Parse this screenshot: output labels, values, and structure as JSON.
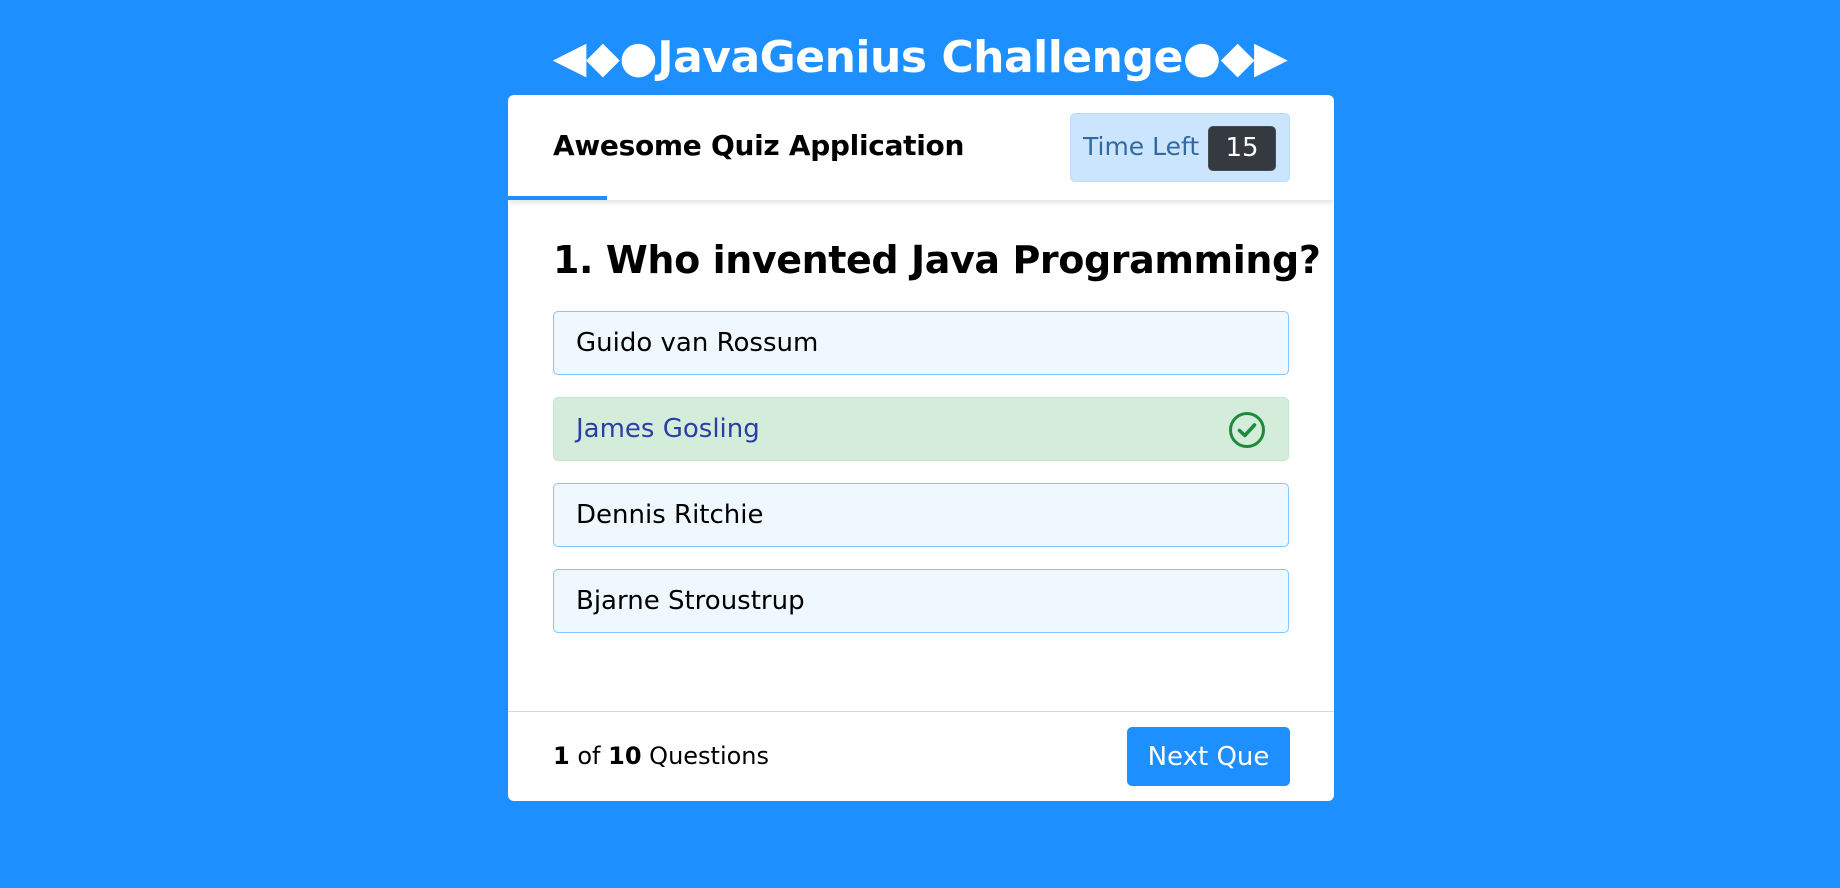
{
  "app": {
    "title": "◀◆●JavaGenius Challenge●◆▶"
  },
  "header": {
    "title": "Awesome Quiz Application",
    "timer_label": "Time Left",
    "timer_value": "15",
    "time_progress": 0.12
  },
  "question": {
    "text": "1. Who invented Java Programming?",
    "options": [
      {
        "label": "Guido van Rossum",
        "state": "default"
      },
      {
        "label": "James Gosling",
        "state": "correct",
        "icon": "check-circle-icon"
      },
      {
        "label": "Dennis Ritchie",
        "state": "default"
      },
      {
        "label": "Bjarne Stroustrup",
        "state": "default"
      }
    ]
  },
  "footer": {
    "current": "1",
    "of": "of",
    "total": "10",
    "suffix": "Questions",
    "next_label": "Next Que"
  },
  "colors": {
    "background": "#1e8fff",
    "accent": "#1e8fff",
    "correct_bg": "#d4edda",
    "correct_icon": "#1e8a3c"
  }
}
